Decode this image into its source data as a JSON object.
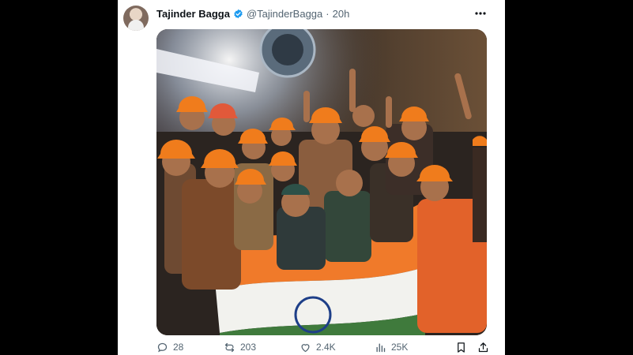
{
  "tweet": {
    "author_name": "Tajinder Bagga",
    "handle": "@TajinderBagga",
    "separator": "·",
    "time": "20h",
    "more_icon": "more-horizontal-icon",
    "verified_color": "#1d9bf0"
  },
  "image": {
    "subject": "group of rescued tunnel workers in orange helmets holding an Indian flag"
  },
  "actions": {
    "replies": "28",
    "reposts": "203",
    "likes": "2.4K",
    "views": "25K"
  }
}
